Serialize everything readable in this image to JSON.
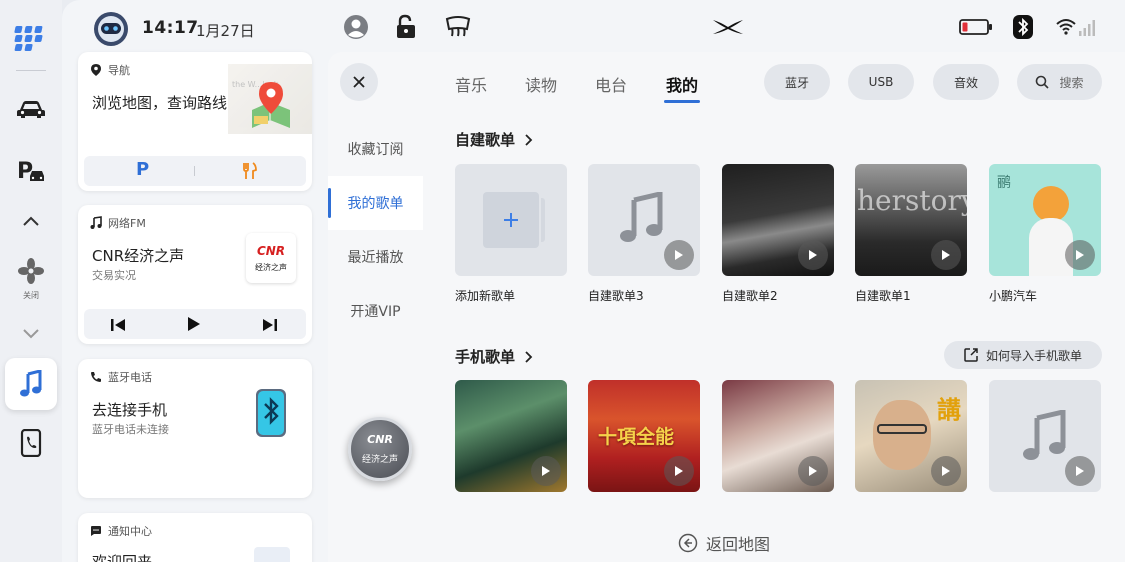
{
  "status": {
    "time": "14:17",
    "date": "1月27日"
  },
  "dock": {
    "fan_label": "关闭"
  },
  "cards": {
    "nav": {
      "title": "导航",
      "main": "浏览地图，查询路线",
      "map_watermark": "the W...lock"
    },
    "fm": {
      "title": "网络FM",
      "station": "CNR经济之声",
      "program": "交易实况",
      "logo_text": "CNR",
      "logo_sub": "经济之声"
    },
    "phone": {
      "title": "蓝牙电话",
      "main": "去连接手机",
      "sub": "蓝牙电话未连接"
    },
    "notify": {
      "title": "通知中心",
      "main": "欢迎回来"
    }
  },
  "music": {
    "tabs": [
      {
        "label": "音乐",
        "active": false
      },
      {
        "label": "读物",
        "active": false
      },
      {
        "label": "电台",
        "active": false
      },
      {
        "label": "我的",
        "active": true
      }
    ],
    "pills": {
      "bluetooth": "蓝牙",
      "usb": "USB",
      "effects": "音效",
      "search": "搜索"
    },
    "side_nav": [
      {
        "label": "收藏订阅",
        "active": false
      },
      {
        "label": "我的歌单",
        "active": true
      },
      {
        "label": "最近播放",
        "active": false
      },
      {
        "label": "开通VIP",
        "active": false
      }
    ],
    "section_custom": {
      "title": "自建歌单",
      "items": [
        {
          "label": "添加新歌单",
          "type": "add"
        },
        {
          "label": "自建歌单3",
          "type": "placeholder"
        },
        {
          "label": "自建歌单2",
          "type": "dark"
        },
        {
          "label": "自建歌单1",
          "type": "herstory",
          "cover_text": "herstory"
        },
        {
          "label": "小鹏汽车",
          "type": "mint",
          "cover_text": "鹂"
        }
      ]
    },
    "section_phone": {
      "title": "手机歌单",
      "import_label": "如何导入手机歌单",
      "items": [
        {
          "type": "green"
        },
        {
          "type": "redgold",
          "cover_text": "十項全能"
        },
        {
          "type": "portrait"
        },
        {
          "type": "man",
          "cover_text": "講"
        },
        {
          "type": "placeholder"
        }
      ]
    },
    "back_to_map": "返回地图",
    "floating": {
      "logo": "CNR",
      "sub": "经济之声"
    }
  },
  "colors": {
    "accent": "#2f6fd6",
    "panel": "#f3f5f8",
    "pill": "#e3e6eb"
  }
}
